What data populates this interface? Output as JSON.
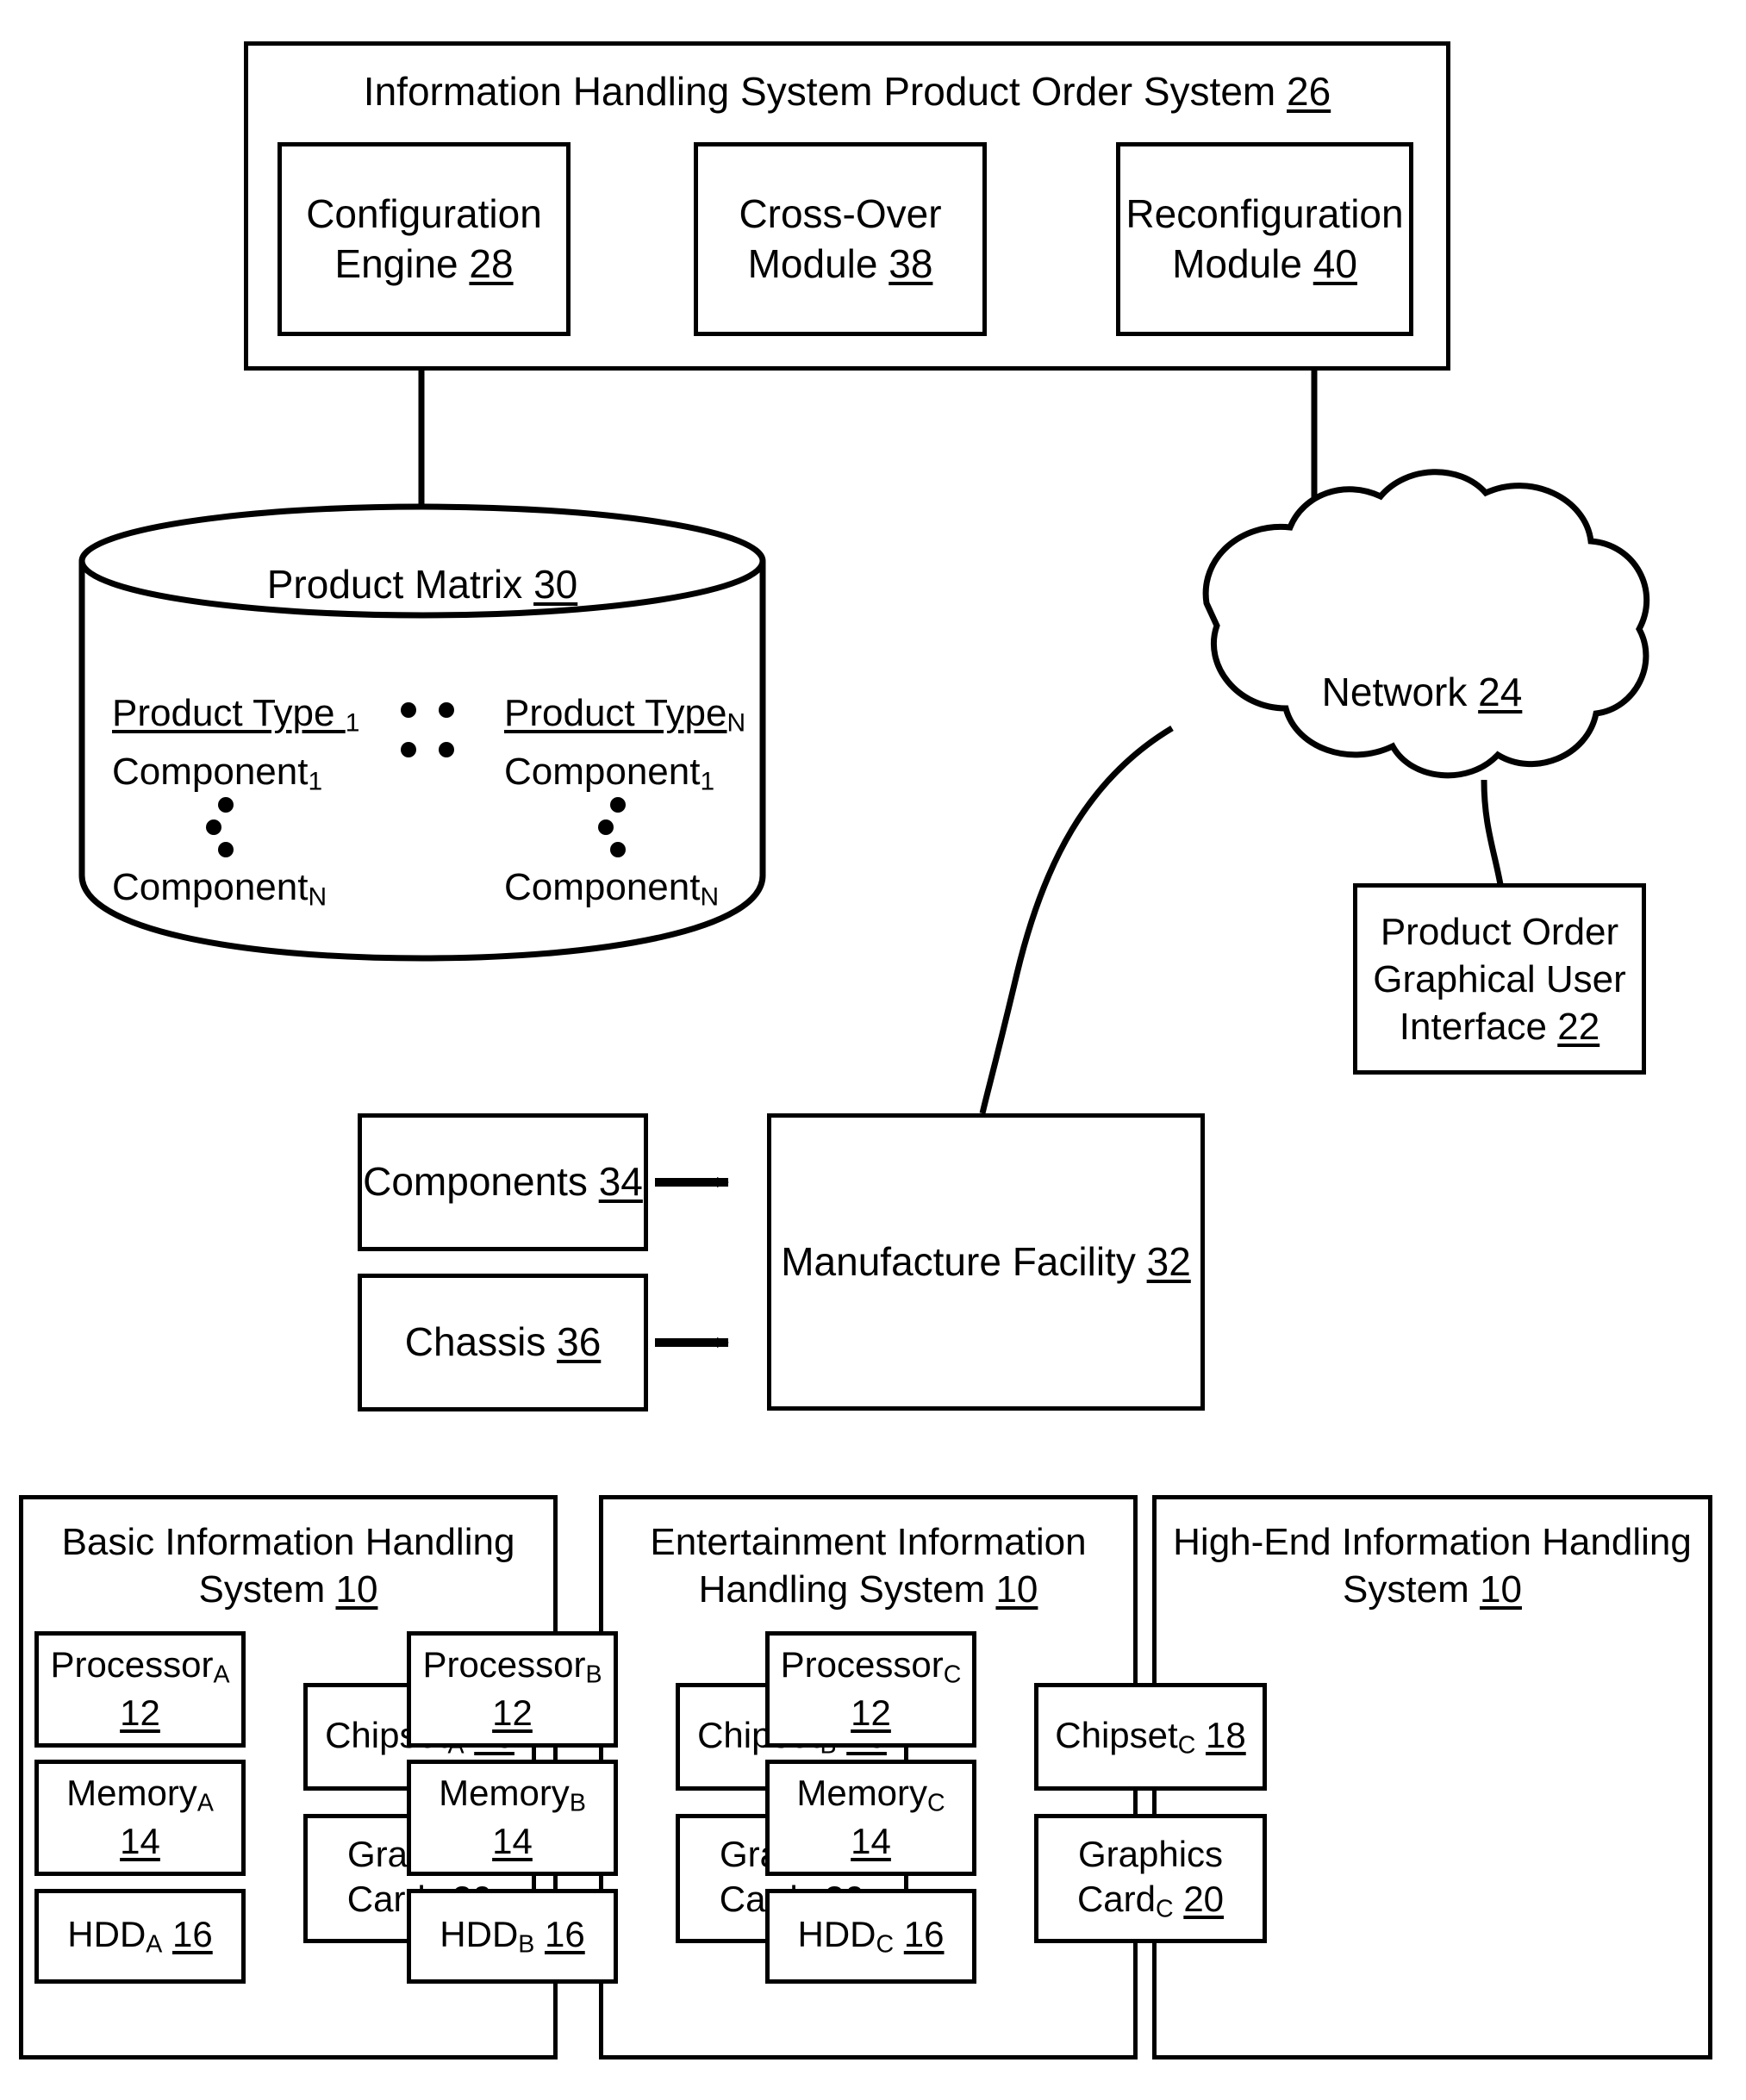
{
  "figure": {
    "title": "Information Handling System Product Order System",
    "title_ref": "26"
  },
  "order_system": {
    "modules": [
      {
        "name": "configuration-engine",
        "line1": "Configuration",
        "line2": "Engine",
        "ref": "28"
      },
      {
        "name": "cross-over-module",
        "line1": "Cross-Over",
        "line2": "Module",
        "ref": "38"
      },
      {
        "name": "reconfiguration-module",
        "line1": "Reconfiguration",
        "line2": "Module",
        "ref": "40"
      }
    ]
  },
  "product_matrix": {
    "title": "Product Matrix",
    "title_ref": "30",
    "columns": [
      {
        "name": "product-type-1",
        "type_label": "Product Type",
        "type_sub": "1",
        "component_first": "Component",
        "component_first_sub": "1",
        "component_last": "Component",
        "component_last_sub": "N"
      },
      {
        "name": "product-type-n",
        "type_label": "Product Type",
        "type_sub": "N",
        "component_first": "Component",
        "component_first_sub": "1",
        "component_last": "Component",
        "component_last_sub": "N"
      }
    ]
  },
  "network": {
    "label": "Network",
    "ref": "24"
  },
  "gui": {
    "line1": "Product Order",
    "line2": "Graphical User",
    "line3": "Interface",
    "ref": "22"
  },
  "manufacture": {
    "facility_label": "Manufacture Facility",
    "facility_ref": "32",
    "components_label": "Components",
    "components_ref": "34",
    "chassis_label": "Chassis",
    "chassis_ref": "36"
  },
  "systems": [
    {
      "name": "basic-information-handling-system",
      "title_line1": "Basic Information Handling",
      "title_line2": "System",
      "title_ref": "10",
      "processor": {
        "label": "Processor",
        "sub": "A",
        "ref": "12"
      },
      "memory": {
        "label": "Memory",
        "sub": "A",
        "ref": "14"
      },
      "hdd": {
        "label": "HDD",
        "sub": "A",
        "ref": "16"
      },
      "chipset": {
        "label": "Chipset",
        "sub": "A",
        "ref": "18"
      },
      "graphics": {
        "line1": "Graphics",
        "line2": "Card",
        "sub": "A",
        "ref": "20"
      }
    },
    {
      "name": "entertainment-information-handling-system",
      "title_line1": "Entertainment Information",
      "title_line2": "Handling System",
      "title_ref": "10",
      "processor": {
        "label": "Processor",
        "sub": "B",
        "ref": "12"
      },
      "memory": {
        "label": "Memory",
        "sub": "B",
        "ref": "14"
      },
      "hdd": {
        "label": "HDD",
        "sub": "B",
        "ref": "16"
      },
      "chipset": {
        "label": "Chipset",
        "sub": "B",
        "ref": "18"
      },
      "graphics": {
        "line1": "Graphics",
        "line2": "Card",
        "sub": "B",
        "ref": "20"
      }
    },
    {
      "name": "high-end-information-handling-system",
      "title_line1": "High-End Information Handling",
      "title_line2": "System",
      "title_ref": "10",
      "processor": {
        "label": "Processor",
        "sub": "C",
        "ref": "12"
      },
      "memory": {
        "label": "Memory",
        "sub": "C",
        "ref": "14"
      },
      "hdd": {
        "label": "HDD",
        "sub": "C",
        "ref": "16"
      },
      "chipset": {
        "label": "Chipset",
        "sub": "C",
        "ref": "18"
      },
      "graphics": {
        "line1": "Graphics",
        "line2": "Card",
        "sub": "C",
        "ref": "20"
      }
    }
  ],
  "colors": {
    "ink": "#000000",
    "paper": "#ffffff"
  }
}
